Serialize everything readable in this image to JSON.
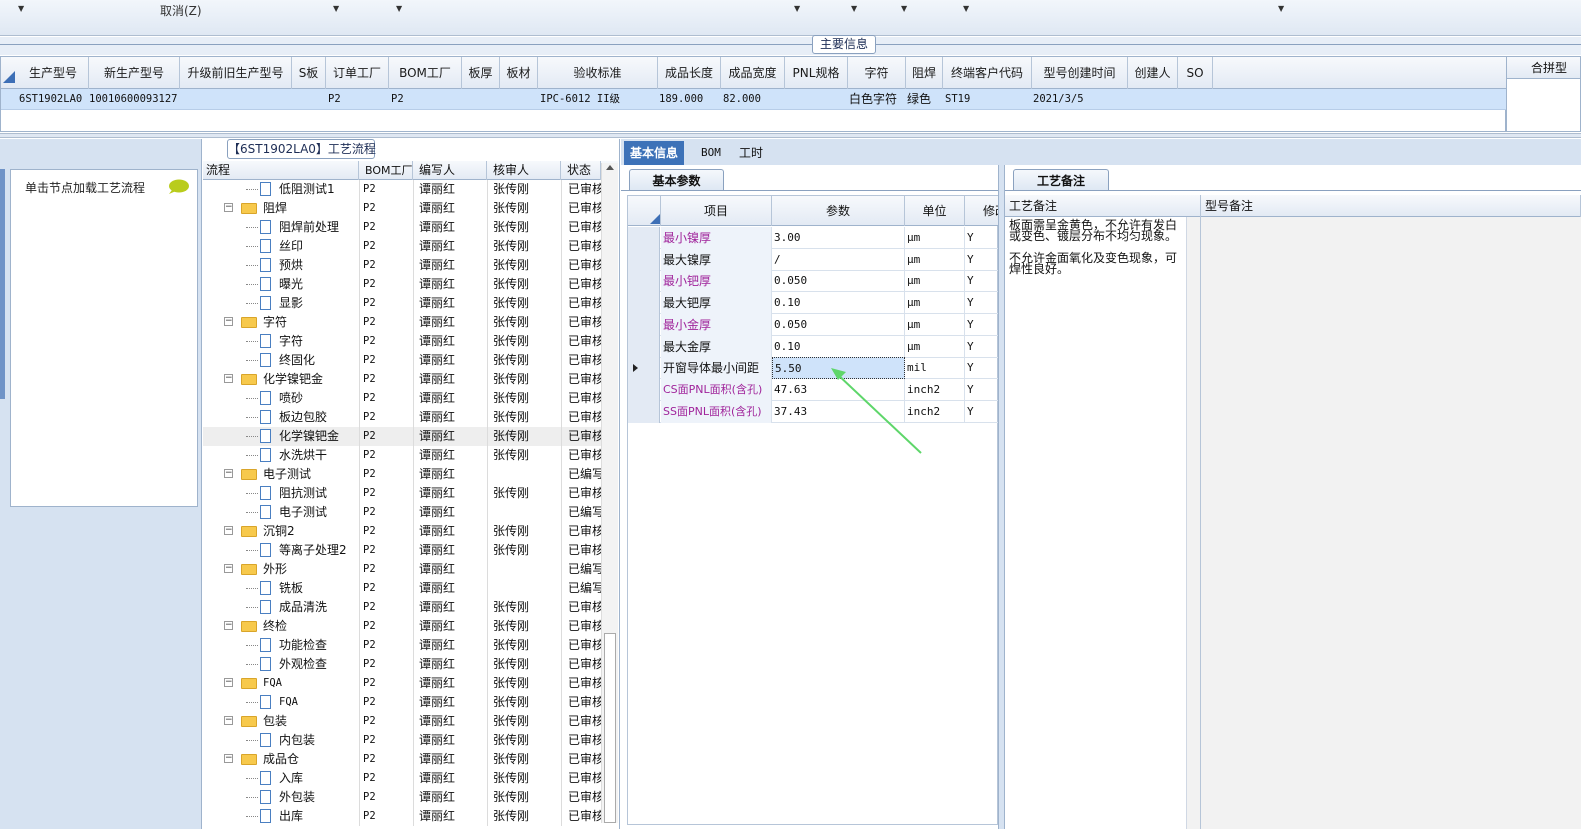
{
  "toolbar": {
    "cancel_label": "取消(Z)"
  },
  "main_info": {
    "title": "主要信息",
    "columns": [
      "生产型号",
      "新生产型号",
      "升级前旧生产型号",
      "S板",
      "订单工厂",
      "BOM工厂",
      "板厚",
      "板材",
      "验收标准",
      "成品长度",
      "成品宽度",
      "PNL规格",
      "字符",
      "阻焊",
      "终端客户代码",
      "型号创建时间",
      "创建人",
      "SO"
    ],
    "row": [
      "6ST1902LA0",
      "10010600093127",
      "",
      "",
      "P2",
      "P2",
      "",
      "",
      "IPC-6012 II级",
      "189.000",
      "82.000",
      "",
      "白色字符",
      "绿色",
      "ST19",
      "2021/3/5",
      "",
      ""
    ],
    "merge_label": "合拼型"
  },
  "left_panel": {
    "hint": "单击节点加载工艺流程"
  },
  "process_tree": {
    "title": "【6ST1902LA0】工艺流程",
    "columns": [
      "流程",
      "BOM工厂",
      "编写人",
      "核审人",
      "状态"
    ],
    "rows": [
      {
        "name": "低阻测试1",
        "level": 1,
        "factory": "P2",
        "writer": "谭丽红",
        "reviewer": "张传刚",
        "status": "已审核"
      },
      {
        "name": "阻焊",
        "level": 0,
        "factory": "P2",
        "writer": "谭丽红",
        "reviewer": "张传刚",
        "status": "已审核"
      },
      {
        "name": "阻焊前处理",
        "level": 1,
        "factory": "P2",
        "writer": "谭丽红",
        "reviewer": "张传刚",
        "status": "已审核"
      },
      {
        "name": "丝印",
        "level": 1,
        "factory": "P2",
        "writer": "谭丽红",
        "reviewer": "张传刚",
        "status": "已审核"
      },
      {
        "name": "预烘",
        "level": 1,
        "factory": "P2",
        "writer": "谭丽红",
        "reviewer": "张传刚",
        "status": "已审核"
      },
      {
        "name": "曝光",
        "level": 1,
        "factory": "P2",
        "writer": "谭丽红",
        "reviewer": "张传刚",
        "status": "已审核"
      },
      {
        "name": "显影",
        "level": 1,
        "factory": "P2",
        "writer": "谭丽红",
        "reviewer": "张传刚",
        "status": "已审核"
      },
      {
        "name": "字符",
        "level": 0,
        "factory": "P2",
        "writer": "谭丽红",
        "reviewer": "张传刚",
        "status": "已审核"
      },
      {
        "name": "字符",
        "level": 1,
        "factory": "P2",
        "writer": "谭丽红",
        "reviewer": "张传刚",
        "status": "已审核"
      },
      {
        "name": "终固化",
        "level": 1,
        "factory": "P2",
        "writer": "谭丽红",
        "reviewer": "张传刚",
        "status": "已审核"
      },
      {
        "name": "化学镍钯金",
        "level": 0,
        "factory": "P2",
        "writer": "谭丽红",
        "reviewer": "张传刚",
        "status": "已审核"
      },
      {
        "name": "喷砂",
        "level": 1,
        "factory": "P2",
        "writer": "谭丽红",
        "reviewer": "张传刚",
        "status": "已审核"
      },
      {
        "name": "板边包胶",
        "level": 1,
        "factory": "P2",
        "writer": "谭丽红",
        "reviewer": "张传刚",
        "status": "已审核"
      },
      {
        "name": "化学镍钯金",
        "level": 1,
        "factory": "P2",
        "writer": "谭丽红",
        "reviewer": "张传刚",
        "status": "已审核",
        "selected": true
      },
      {
        "name": "水洗烘干",
        "level": 1,
        "factory": "P2",
        "writer": "谭丽红",
        "reviewer": "张传刚",
        "status": "已审核"
      },
      {
        "name": "电子测试",
        "level": 0,
        "factory": "P2",
        "writer": "谭丽红",
        "reviewer": "",
        "status": "已编写"
      },
      {
        "name": "阻抗测试",
        "level": 1,
        "factory": "P2",
        "writer": "谭丽红",
        "reviewer": "张传刚",
        "status": "已审核"
      },
      {
        "name": "电子测试",
        "level": 1,
        "factory": "P2",
        "writer": "谭丽红",
        "reviewer": "",
        "status": "已编写"
      },
      {
        "name": "沉铜2",
        "level": 0,
        "factory": "P2",
        "writer": "谭丽红",
        "reviewer": "张传刚",
        "status": "已审核"
      },
      {
        "name": "等离子处理2",
        "level": 1,
        "factory": "P2",
        "writer": "谭丽红",
        "reviewer": "张传刚",
        "status": "已审核"
      },
      {
        "name": "外形",
        "level": 0,
        "factory": "P2",
        "writer": "谭丽红",
        "reviewer": "",
        "status": "已编写"
      },
      {
        "name": "铣板",
        "level": 1,
        "factory": "P2",
        "writer": "谭丽红",
        "reviewer": "",
        "status": "已编写"
      },
      {
        "name": "成品清洗",
        "level": 1,
        "factory": "P2",
        "writer": "谭丽红",
        "reviewer": "张传刚",
        "status": "已审核"
      },
      {
        "name": "终检",
        "level": 0,
        "factory": "P2",
        "writer": "谭丽红",
        "reviewer": "张传刚",
        "status": "已审核"
      },
      {
        "name": "功能检查",
        "level": 1,
        "factory": "P2",
        "writer": "谭丽红",
        "reviewer": "张传刚",
        "status": "已审核"
      },
      {
        "name": "外观检查",
        "level": 1,
        "factory": "P2",
        "writer": "谭丽红",
        "reviewer": "张传刚",
        "status": "已审核"
      },
      {
        "name": "FQA",
        "level": 0,
        "factory": "P2",
        "writer": "谭丽红",
        "reviewer": "张传刚",
        "status": "已审核"
      },
      {
        "name": "FQA",
        "level": 1,
        "factory": "P2",
        "writer": "谭丽红",
        "reviewer": "张传刚",
        "status": "已审核"
      },
      {
        "name": "包装",
        "level": 0,
        "factory": "P2",
        "writer": "谭丽红",
        "reviewer": "张传刚",
        "status": "已审核"
      },
      {
        "name": "内包装",
        "level": 1,
        "factory": "P2",
        "writer": "谭丽红",
        "reviewer": "张传刚",
        "status": "已审核"
      },
      {
        "name": "成品仓",
        "level": 0,
        "factory": "P2",
        "writer": "谭丽红",
        "reviewer": "张传刚",
        "status": "已审核"
      },
      {
        "name": "入库",
        "level": 1,
        "factory": "P2",
        "writer": "谭丽红",
        "reviewer": "张传刚",
        "status": "已审核"
      },
      {
        "name": "外包装",
        "level": 1,
        "factory": "P2",
        "writer": "谭丽红",
        "reviewer": "张传刚",
        "status": "已审核"
      },
      {
        "name": "出库",
        "level": 1,
        "factory": "P2",
        "writer": "谭丽红",
        "reviewer": "张传刚",
        "status": "已审核"
      }
    ]
  },
  "tabs": [
    {
      "label": "基本信息",
      "active": true
    },
    {
      "label": "BOM"
    },
    {
      "label": "工时"
    }
  ],
  "basic_params": {
    "tab_label": "基本参数",
    "columns": [
      "项目",
      "参数",
      "单位",
      "修改"
    ],
    "rows": [
      {
        "item": "最小镍厚",
        "value": "3.00",
        "unit": "μm",
        "flag": "Y",
        "highlight": true
      },
      {
        "item": "最大镍厚",
        "value": "/",
        "unit": "μm",
        "flag": "Y"
      },
      {
        "item": "最小钯厚",
        "value": "0.050",
        "unit": "μm",
        "flag": "Y",
        "highlight": true
      },
      {
        "item": "最大钯厚",
        "value": "0.10",
        "unit": "μm",
        "flag": "Y"
      },
      {
        "item": "最小金厚",
        "value": "0.050",
        "unit": "μm",
        "flag": "Y",
        "highlight": true
      },
      {
        "item": "最大金厚",
        "value": "0.10",
        "unit": "μm",
        "flag": "Y"
      },
      {
        "item": "开窗导体最小间距",
        "value": "5.50",
        "unit": "mil",
        "flag": "Y",
        "current": true
      },
      {
        "item": "CS面PNL面积(含孔)",
        "value": "47.63",
        "unit": "inch2",
        "flag": "Y",
        "highlight": true
      },
      {
        "item": "SS面PNL面积(含孔)",
        "value": "37.43",
        "unit": "inch2",
        "flag": "Y",
        "highlight": true
      }
    ]
  },
  "process_notes": {
    "tab_label": "工艺备注",
    "columns": [
      "工艺备注",
      "型号备注"
    ],
    "note_lines": [
      "板面需呈金黄色，不允许有发白",
      "或变色、镀层分布不均匀现象。",
      "",
      "不允许金面氧化及变色现象，可",
      "焊性良好。"
    ]
  },
  "colors": {
    "accent": "#3d72b8",
    "selected_row": "#cfe3fa",
    "purple_text": "#a0249b",
    "annotation_arrow": "#5ed66a"
  }
}
